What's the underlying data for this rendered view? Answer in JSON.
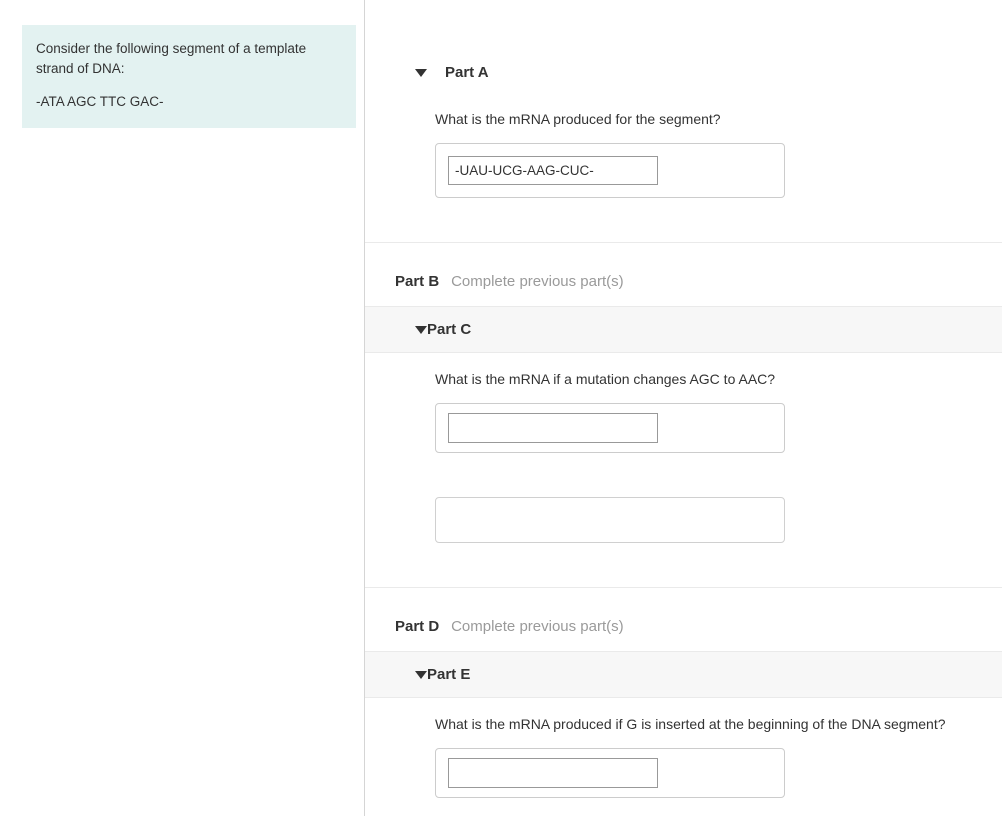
{
  "prompt": {
    "intro": "Consider the following segment of a template strand of DNA:",
    "sequence": "-ATA AGC TTC GAC-"
  },
  "parts": {
    "a": {
      "label": "Part A",
      "question": "What is the mRNA produced for the segment?",
      "answer_value": "-UAU-UCG-AAG-CUC-"
    },
    "b": {
      "label": "Part B",
      "locked_msg": "Complete previous part(s)"
    },
    "c": {
      "label": "Part C",
      "question": "What is the mRNA if a mutation changes AGC to AAC?",
      "answer_value": ""
    },
    "d": {
      "label": "Part D",
      "locked_msg": "Complete previous part(s)"
    },
    "e": {
      "label": "Part E",
      "question": "What is the mRNA produced if G is inserted at the beginning of the DNA segment?",
      "answer_value": ""
    }
  }
}
